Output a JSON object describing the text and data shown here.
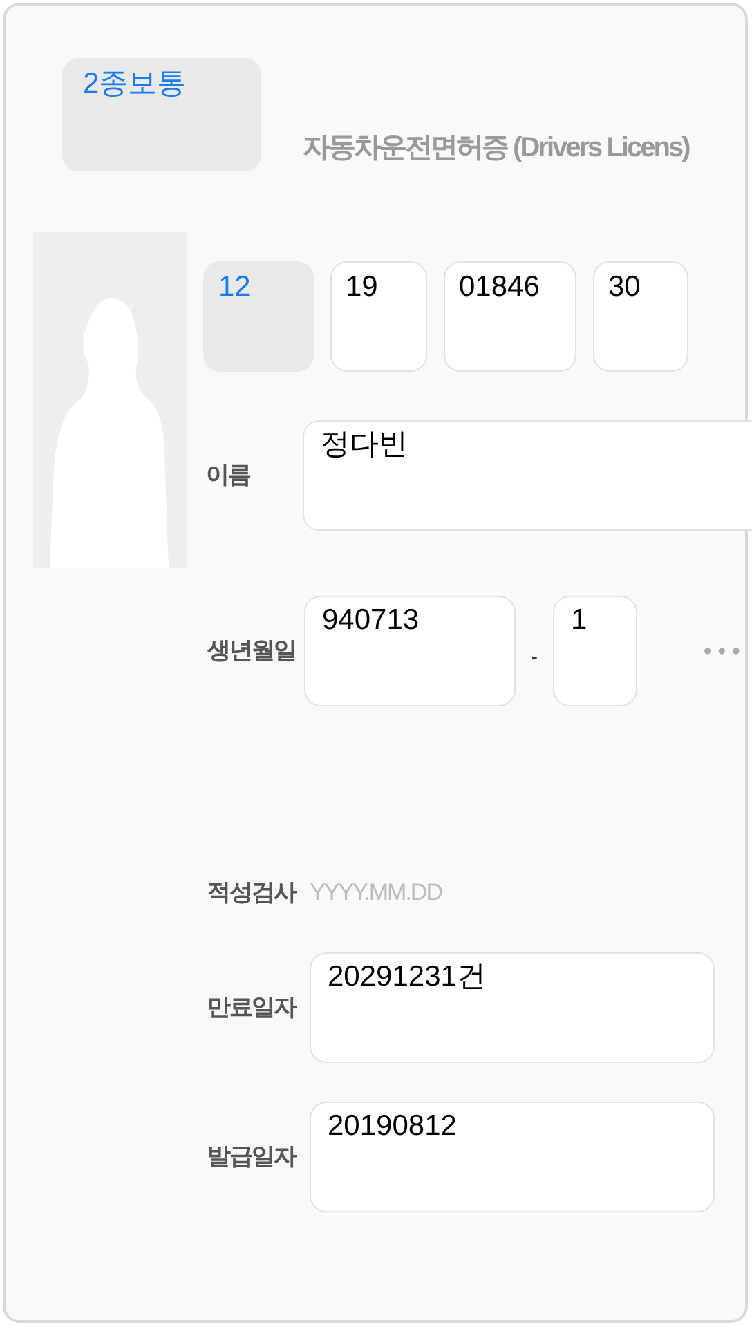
{
  "license_type": {
    "value": "2종보통",
    "kind": "select"
  },
  "title": "자동차운전면허증 (Drivers Licens)",
  "license_number": [
    {
      "value": "12",
      "kind": "select"
    },
    {
      "value": "19",
      "kind": "input"
    },
    {
      "value": "01846",
      "kind": "input"
    },
    {
      "value": "30",
      "kind": "input"
    }
  ],
  "name": {
    "label": "이름",
    "value": "정다빈"
  },
  "birth": {
    "label": "생년월일",
    "front": "940713",
    "separator": "-",
    "back": "1"
  },
  "aptitude_test": {
    "label": "적성검사",
    "placeholder": "YYYY.MM.DD"
  },
  "expiry_date": {
    "label": "만료일자",
    "value": "20291231건"
  },
  "issue_date": {
    "label": "발급일자",
    "value": "20190812"
  }
}
